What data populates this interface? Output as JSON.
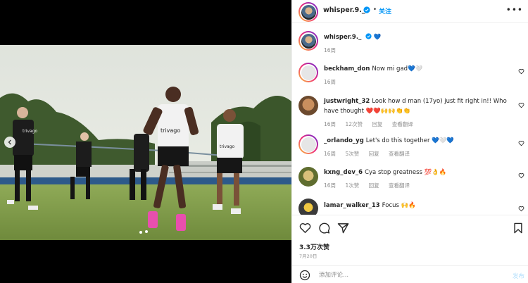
{
  "post": {
    "author": "whisper.9._",
    "follow_label": "关注",
    "dot": "•",
    "more": "•••",
    "caption_emoji": "💙",
    "caption_time": "16周"
  },
  "comments": [
    {
      "user": "beckham_don",
      "text": "Now mi gad💙🤍",
      "time": "16周",
      "likes": "",
      "reply": "回复",
      "translate": ""
    },
    {
      "user": "justwright_32",
      "text": "Look how d man (17yo) just fit right in!! Who have thought ❤️❤️🙌🙌👏👏",
      "time": "16周",
      "likes": "12次赞",
      "reply": "回复",
      "translate": "查看翻译"
    },
    {
      "user": "_orlando_yg",
      "text": "Let's do this together 💙🤍💙",
      "time": "16周",
      "likes": "5次赞",
      "reply": "回复",
      "translate": "查看翻译"
    },
    {
      "user": "kxng_dev_6",
      "text": "Cya stop greatness 💯👌🔥",
      "time": "16周",
      "likes": "1次赞",
      "reply": "回复",
      "translate": "查看翻译"
    },
    {
      "user": "lamar_walker_13",
      "text": "Focus 🙌🔥",
      "time": "",
      "likes": "",
      "reply": "",
      "translate": ""
    }
  ],
  "stats": {
    "views": "3.3万次赞",
    "date": "7月20日"
  },
  "compose": {
    "placeholder": "添加评论...",
    "post_label": "发布"
  },
  "photo": {
    "jersey_text": "trivago"
  },
  "colors": {
    "accent": "#0095f6",
    "verified": "#0095f6",
    "heart_blue": "#1d7ee8"
  }
}
